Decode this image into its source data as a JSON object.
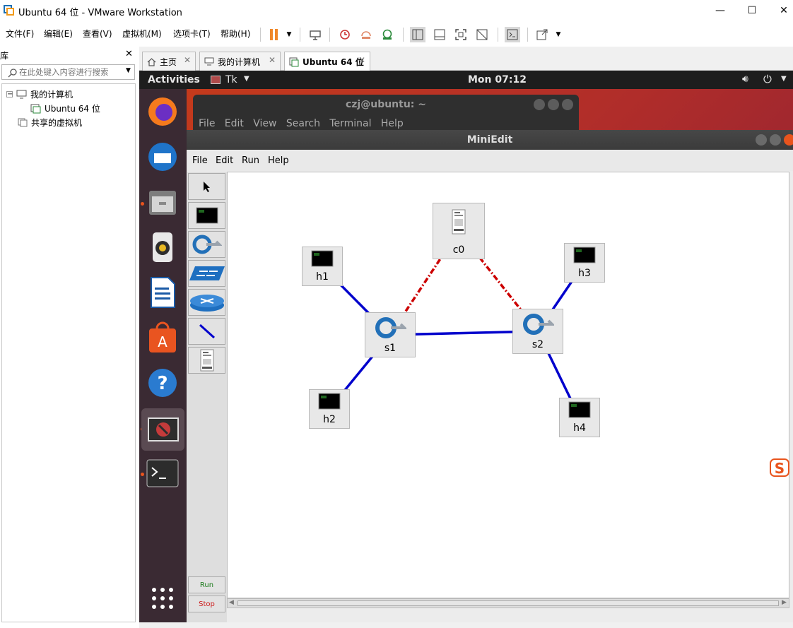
{
  "window": {
    "title": "Ubuntu 64 位 - VMware Workstation"
  },
  "menu": [
    "文件(F)",
    "编辑(E)",
    "查看(V)",
    "虚拟机(M)",
    "选项卡(T)",
    "帮助(H)"
  ],
  "library": {
    "title": "库",
    "search_placeholder": "在此处键入内容进行搜索",
    "tree": [
      "我的计算机",
      "Ubuntu 64 位",
      "共享的虚拟机"
    ]
  },
  "tabs": [
    "主页",
    "我的计算机",
    "Ubuntu 64 位"
  ],
  "guest": {
    "activities": "Activities",
    "app_menu": "Tk",
    "clock": "Mon 07:12"
  },
  "terminal": {
    "title": "czj@ubuntu: ~",
    "menu": [
      "File",
      "Edit",
      "View",
      "Search",
      "Terminal",
      "Help"
    ]
  },
  "miniedit": {
    "title": "MiniEdit",
    "menu": [
      "File",
      "Edit",
      "Run",
      "Help"
    ],
    "run_label": "Run",
    "stop_label": "Stop",
    "nodes": [
      {
        "id": "c0",
        "type": "controller"
      },
      {
        "id": "h1",
        "type": "host"
      },
      {
        "id": "h2",
        "type": "host"
      },
      {
        "id": "h3",
        "type": "host"
      },
      {
        "id": "h4",
        "type": "host"
      },
      {
        "id": "s1",
        "type": "switch"
      },
      {
        "id": "s2",
        "type": "switch"
      }
    ],
    "links": [
      [
        "h1",
        "s1"
      ],
      [
        "h2",
        "s1"
      ],
      [
        "s1",
        "s2"
      ],
      [
        "s2",
        "h3"
      ],
      [
        "s2",
        "h4"
      ]
    ],
    "controller_links": [
      [
        "c0",
        "s1"
      ],
      [
        "c0",
        "s2"
      ]
    ]
  },
  "colors": {
    "link": "#0000cc",
    "controller_link": "#cc0000",
    "dock": "#3a2a33",
    "topbar": "#1d1d1d",
    "accent": "#e9541d"
  }
}
